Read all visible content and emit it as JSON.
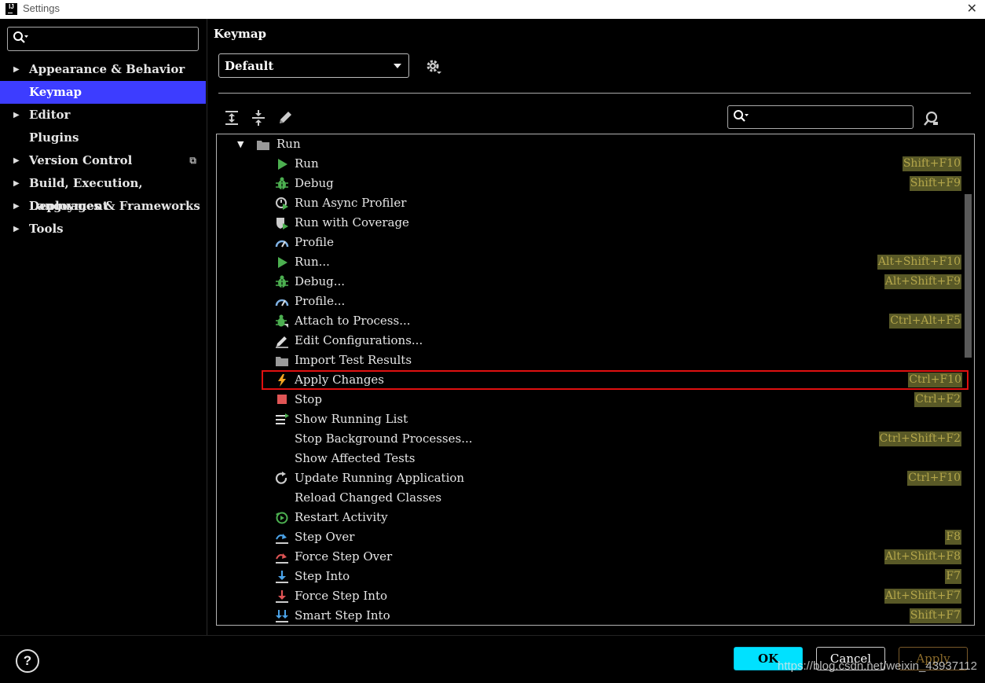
{
  "window": {
    "title": "Settings"
  },
  "sidebar": {
    "items": [
      {
        "label": "Appearance & Behavior",
        "arrow": "▶"
      },
      {
        "label": "Keymap",
        "selected": true
      },
      {
        "label": "Editor",
        "arrow": "▶"
      },
      {
        "label": "Plugins"
      },
      {
        "label": "Version Control",
        "arrow": "▶",
        "extra": "copy-icon"
      },
      {
        "label": "Build, Execution, Deployment",
        "arrow": "▶"
      },
      {
        "label": "Languages & Frameworks",
        "arrow": "▶"
      },
      {
        "label": "Tools",
        "arrow": "▶"
      }
    ]
  },
  "main": {
    "title": "Keymap",
    "keymap_select": "Default",
    "tree": {
      "group": "Run",
      "group_expander": "▼",
      "actions": [
        {
          "label": "Run",
          "shortcut": "Shift+F10",
          "icon": "run-icon"
        },
        {
          "label": "Debug",
          "shortcut": "Shift+F9",
          "icon": "debug-icon"
        },
        {
          "label": "Run Async Profiler",
          "shortcut": "",
          "icon": "async-profiler-icon"
        },
        {
          "label": "Run with Coverage",
          "shortcut": "",
          "icon": "coverage-icon"
        },
        {
          "label": "Profile",
          "shortcut": "",
          "icon": "profile-icon"
        },
        {
          "label": "Run...",
          "shortcut": "Alt+Shift+F10",
          "icon": "run-icon"
        },
        {
          "label": "Debug...",
          "shortcut": "Alt+Shift+F9",
          "icon": "debug-icon"
        },
        {
          "label": "Profile...",
          "shortcut": "",
          "icon": "profile-icon"
        },
        {
          "label": "Attach to Process...",
          "shortcut": "Ctrl+Alt+F5",
          "icon": "attach-icon"
        },
        {
          "label": "Edit Configurations...",
          "shortcut": "",
          "icon": "edit-icon"
        },
        {
          "label": "Import Test Results",
          "shortcut": "",
          "icon": "folder-icon"
        },
        {
          "label": "Apply Changes",
          "shortcut": "Ctrl+F10",
          "icon": "lightning-icon",
          "highlight": true
        },
        {
          "label": "Stop",
          "shortcut": "Ctrl+F2",
          "icon": "stop-icon"
        },
        {
          "label": "Show Running List",
          "shortcut": "",
          "icon": "list-icon"
        },
        {
          "label": "Stop Background Processes...",
          "shortcut": "Ctrl+Shift+F2",
          "icon": ""
        },
        {
          "label": "Show Affected Tests",
          "shortcut": "",
          "icon": ""
        },
        {
          "label": "Update Running Application",
          "shortcut": "Ctrl+F10",
          "icon": "refresh-icon"
        },
        {
          "label": "Reload Changed Classes",
          "shortcut": "",
          "icon": ""
        },
        {
          "label": "Restart Activity",
          "shortcut": "",
          "icon": "restart-icon"
        },
        {
          "label": "Step Over",
          "shortcut": "F8",
          "icon": "step-over-icon"
        },
        {
          "label": "Force Step Over",
          "shortcut": "Alt+Shift+F8",
          "icon": "force-step-over-icon"
        },
        {
          "label": "Step Into",
          "shortcut": "F7",
          "icon": "step-into-icon"
        },
        {
          "label": "Force Step Into",
          "shortcut": "Alt+Shift+F7",
          "icon": "force-step-into-icon"
        },
        {
          "label": "Smart Step Into",
          "shortcut": "Shift+F7",
          "icon": "smart-step-into-icon"
        }
      ]
    }
  },
  "footer": {
    "help": "?",
    "ok": "OK",
    "cancel": "Cancel",
    "apply": "Apply",
    "watermark": "https://blog.csdn.net/weixin_43937112"
  },
  "colors": {
    "selection": "#3d3dff",
    "shortcut_bg": "#595927",
    "shortcut_fg": "#b4a64a",
    "highlight_border": "#e01010",
    "ok_button": "#00e1ff"
  }
}
